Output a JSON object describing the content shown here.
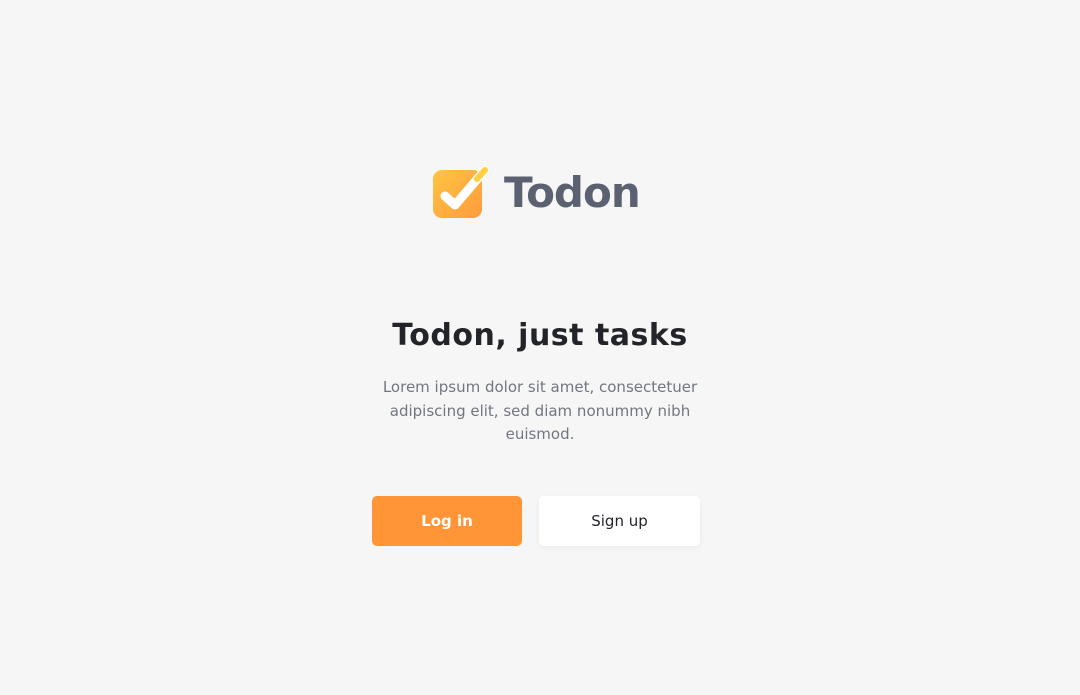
{
  "brand": {
    "name": "Todon",
    "icon": "checkbox-check-icon",
    "colors": {
      "gradient_start": "#ffc33d",
      "gradient_end": "#ff9a3d",
      "text": "#5b6170"
    }
  },
  "hero": {
    "headline": "Todon, just tasks",
    "description": "Lorem ipsum dolor sit amet, consectetuer adipiscing elit, sed diam nonummy nibh euismod."
  },
  "actions": {
    "login_label": "Log in",
    "signup_label": "Sign up"
  },
  "colors": {
    "background": "#f6f6f6",
    "accent": "#ff9537",
    "secondary_button": "#ffffff"
  }
}
